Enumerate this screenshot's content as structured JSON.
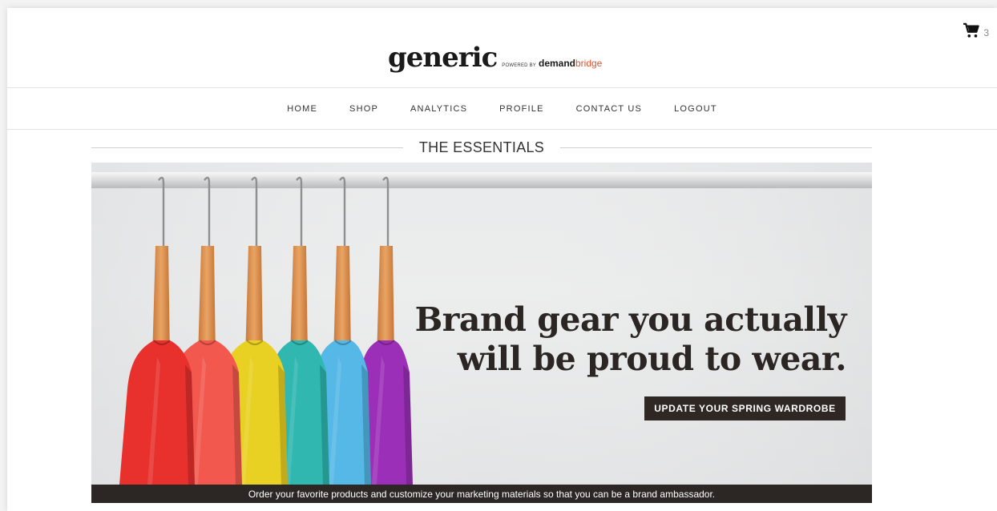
{
  "header": {
    "logo_main": "generic",
    "logo_powered": "POWERED BY",
    "logo_demand": "demand",
    "logo_bridge": "bridge",
    "cart_icon": "shopping-cart-icon",
    "cart_count": "3"
  },
  "nav": {
    "items": [
      {
        "label": "HOME"
      },
      {
        "label": "SHOP"
      },
      {
        "label": "ANALYTICS"
      },
      {
        "label": "PROFILE"
      },
      {
        "label": "CONTACT US"
      },
      {
        "label": "LOGOUT"
      }
    ]
  },
  "section": {
    "title": "THE ESSENTIALS"
  },
  "hero": {
    "headline_line1": "Brand gear you actually",
    "headline_line2": "will be proud to wear.",
    "cta_label": "UPDATE YOUR SPRING WARDROBE",
    "shirt_colors": [
      "#e8302c",
      "#f2584e",
      "#e9d123",
      "#2fb7b0",
      "#55b8e6",
      "#9c2fb8"
    ]
  },
  "footer": {
    "text": "Order your favorite products and customize your marketing materials so that you can be a brand ambassador."
  },
  "colors": {
    "dark": "#2c2724",
    "accent": "#e0542b"
  }
}
